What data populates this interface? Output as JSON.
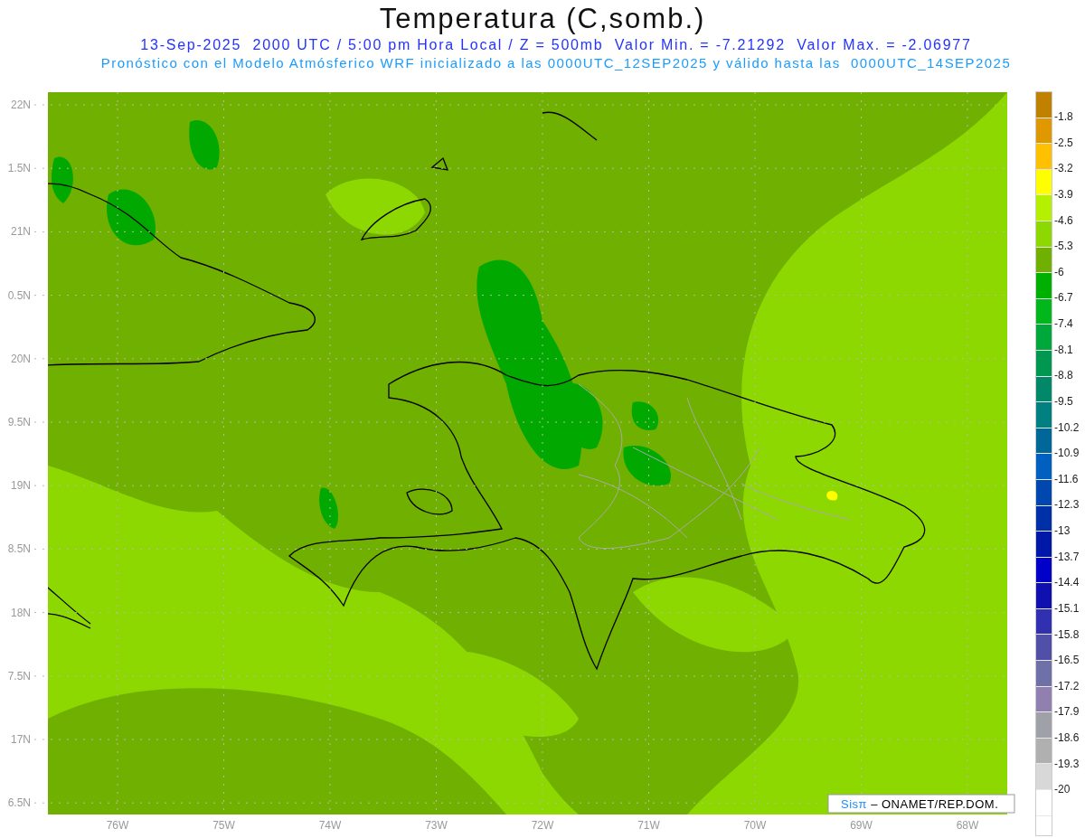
{
  "title": "Temperatura (C,somb.)",
  "subtitle": "13-Sep-2025  2000 UTC / 5:00 pm Hora Local / Z = 500mb  Valor Min. = -7.21292  Valor Max. = -2.06977",
  "forecast_note": "Pronóstico con el Modelo Atmósferico WRF inicializado a las 0000UTC_12SEP2025 y válido hasta las  0000UTC_14SEP2025",
  "map": {
    "lat_labels": [
      "22N",
      "1.5N",
      "21N",
      "0.5N",
      "20N",
      "9.5N",
      "19N",
      "8.5N",
      "18N",
      "7.5N",
      "17N",
      "6.5N"
    ],
    "lon_labels": [
      "76W",
      "75W",
      "74W",
      "73W",
      "72W",
      "71W",
      "70W",
      "69W",
      "68W"
    ],
    "credit": {
      "brand": "Sisπ",
      "text": "– ONAMET/REP.DOM."
    }
  },
  "colorbar": {
    "bins": [
      {
        "color": "#c08000"
      },
      {
        "color": "#e09800"
      },
      {
        "color": "#ffc000"
      },
      {
        "color": "#ffff00"
      },
      {
        "color": "#b4f000"
      },
      {
        "color": "#8cd800"
      },
      {
        "color": "#70b000"
      },
      {
        "color": "#00b000"
      },
      {
        "color": "#00b81c"
      },
      {
        "color": "#00a83c"
      },
      {
        "color": "#009850"
      },
      {
        "color": "#008868"
      },
      {
        "color": "#008080"
      },
      {
        "color": "#006898"
      },
      {
        "color": "#0060c0"
      },
      {
        "color": "#0048b0"
      },
      {
        "color": "#0030a8"
      },
      {
        "color": "#0018a8"
      },
      {
        "color": "#0000c8"
      },
      {
        "color": "#1010b0"
      },
      {
        "color": "#3030b0"
      },
      {
        "color": "#5050a8"
      },
      {
        "color": "#7070a8"
      },
      {
        "color": "#9080b0"
      },
      {
        "color": "#a0a0a8"
      },
      {
        "color": "#b0b0b0"
      },
      {
        "color": "#d8d8d8"
      },
      {
        "color": "#ffffff"
      }
    ],
    "labels": [
      "-1.8",
      "-2.5",
      "-3.2",
      "-3.9",
      "-4.6",
      "-5.3",
      "-6",
      "-6.7",
      "-7.4",
      "-8.1",
      "-8.8",
      "-9.5",
      "-10.2",
      "-10.9",
      "-11.6",
      "-12.3",
      "-13",
      "-13.7",
      "-14.4",
      "-15.1",
      "-15.8",
      "-16.5",
      "-17.2",
      "-17.9",
      "-18.6",
      "-19.3",
      "-20"
    ]
  }
}
